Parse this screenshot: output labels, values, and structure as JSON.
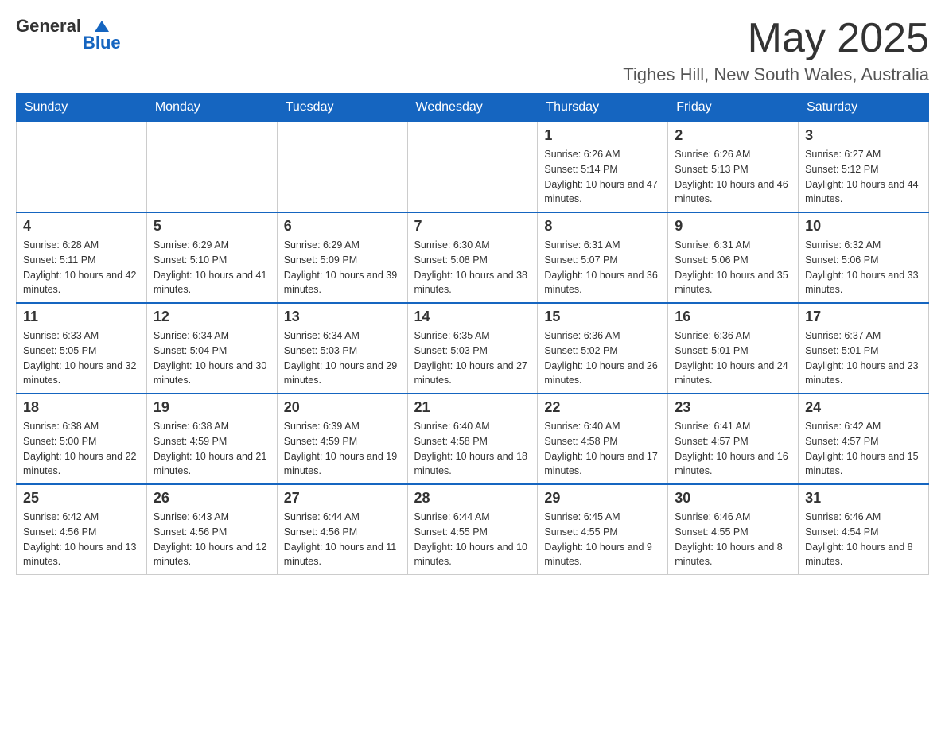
{
  "header": {
    "logo_general": "General",
    "logo_blue": "Blue",
    "month_title": "May 2025",
    "location": "Tighes Hill, New South Wales, Australia"
  },
  "days_of_week": [
    "Sunday",
    "Monday",
    "Tuesday",
    "Wednesday",
    "Thursday",
    "Friday",
    "Saturday"
  ],
  "weeks": [
    [
      {
        "day": "",
        "info": ""
      },
      {
        "day": "",
        "info": ""
      },
      {
        "day": "",
        "info": ""
      },
      {
        "day": "",
        "info": ""
      },
      {
        "day": "1",
        "info": "Sunrise: 6:26 AM\nSunset: 5:14 PM\nDaylight: 10 hours and 47 minutes."
      },
      {
        "day": "2",
        "info": "Sunrise: 6:26 AM\nSunset: 5:13 PM\nDaylight: 10 hours and 46 minutes."
      },
      {
        "day": "3",
        "info": "Sunrise: 6:27 AM\nSunset: 5:12 PM\nDaylight: 10 hours and 44 minutes."
      }
    ],
    [
      {
        "day": "4",
        "info": "Sunrise: 6:28 AM\nSunset: 5:11 PM\nDaylight: 10 hours and 42 minutes."
      },
      {
        "day": "5",
        "info": "Sunrise: 6:29 AM\nSunset: 5:10 PM\nDaylight: 10 hours and 41 minutes."
      },
      {
        "day": "6",
        "info": "Sunrise: 6:29 AM\nSunset: 5:09 PM\nDaylight: 10 hours and 39 minutes."
      },
      {
        "day": "7",
        "info": "Sunrise: 6:30 AM\nSunset: 5:08 PM\nDaylight: 10 hours and 38 minutes."
      },
      {
        "day": "8",
        "info": "Sunrise: 6:31 AM\nSunset: 5:07 PM\nDaylight: 10 hours and 36 minutes."
      },
      {
        "day": "9",
        "info": "Sunrise: 6:31 AM\nSunset: 5:06 PM\nDaylight: 10 hours and 35 minutes."
      },
      {
        "day": "10",
        "info": "Sunrise: 6:32 AM\nSunset: 5:06 PM\nDaylight: 10 hours and 33 minutes."
      }
    ],
    [
      {
        "day": "11",
        "info": "Sunrise: 6:33 AM\nSunset: 5:05 PM\nDaylight: 10 hours and 32 minutes."
      },
      {
        "day": "12",
        "info": "Sunrise: 6:34 AM\nSunset: 5:04 PM\nDaylight: 10 hours and 30 minutes."
      },
      {
        "day": "13",
        "info": "Sunrise: 6:34 AM\nSunset: 5:03 PM\nDaylight: 10 hours and 29 minutes."
      },
      {
        "day": "14",
        "info": "Sunrise: 6:35 AM\nSunset: 5:03 PM\nDaylight: 10 hours and 27 minutes."
      },
      {
        "day": "15",
        "info": "Sunrise: 6:36 AM\nSunset: 5:02 PM\nDaylight: 10 hours and 26 minutes."
      },
      {
        "day": "16",
        "info": "Sunrise: 6:36 AM\nSunset: 5:01 PM\nDaylight: 10 hours and 24 minutes."
      },
      {
        "day": "17",
        "info": "Sunrise: 6:37 AM\nSunset: 5:01 PM\nDaylight: 10 hours and 23 minutes."
      }
    ],
    [
      {
        "day": "18",
        "info": "Sunrise: 6:38 AM\nSunset: 5:00 PM\nDaylight: 10 hours and 22 minutes."
      },
      {
        "day": "19",
        "info": "Sunrise: 6:38 AM\nSunset: 4:59 PM\nDaylight: 10 hours and 21 minutes."
      },
      {
        "day": "20",
        "info": "Sunrise: 6:39 AM\nSunset: 4:59 PM\nDaylight: 10 hours and 19 minutes."
      },
      {
        "day": "21",
        "info": "Sunrise: 6:40 AM\nSunset: 4:58 PM\nDaylight: 10 hours and 18 minutes."
      },
      {
        "day": "22",
        "info": "Sunrise: 6:40 AM\nSunset: 4:58 PM\nDaylight: 10 hours and 17 minutes."
      },
      {
        "day": "23",
        "info": "Sunrise: 6:41 AM\nSunset: 4:57 PM\nDaylight: 10 hours and 16 minutes."
      },
      {
        "day": "24",
        "info": "Sunrise: 6:42 AM\nSunset: 4:57 PM\nDaylight: 10 hours and 15 minutes."
      }
    ],
    [
      {
        "day": "25",
        "info": "Sunrise: 6:42 AM\nSunset: 4:56 PM\nDaylight: 10 hours and 13 minutes."
      },
      {
        "day": "26",
        "info": "Sunrise: 6:43 AM\nSunset: 4:56 PM\nDaylight: 10 hours and 12 minutes."
      },
      {
        "day": "27",
        "info": "Sunrise: 6:44 AM\nSunset: 4:56 PM\nDaylight: 10 hours and 11 minutes."
      },
      {
        "day": "28",
        "info": "Sunrise: 6:44 AM\nSunset: 4:55 PM\nDaylight: 10 hours and 10 minutes."
      },
      {
        "day": "29",
        "info": "Sunrise: 6:45 AM\nSunset: 4:55 PM\nDaylight: 10 hours and 9 minutes."
      },
      {
        "day": "30",
        "info": "Sunrise: 6:46 AM\nSunset: 4:55 PM\nDaylight: 10 hours and 8 minutes."
      },
      {
        "day": "31",
        "info": "Sunrise: 6:46 AM\nSunset: 4:54 PM\nDaylight: 10 hours and 8 minutes."
      }
    ]
  ]
}
